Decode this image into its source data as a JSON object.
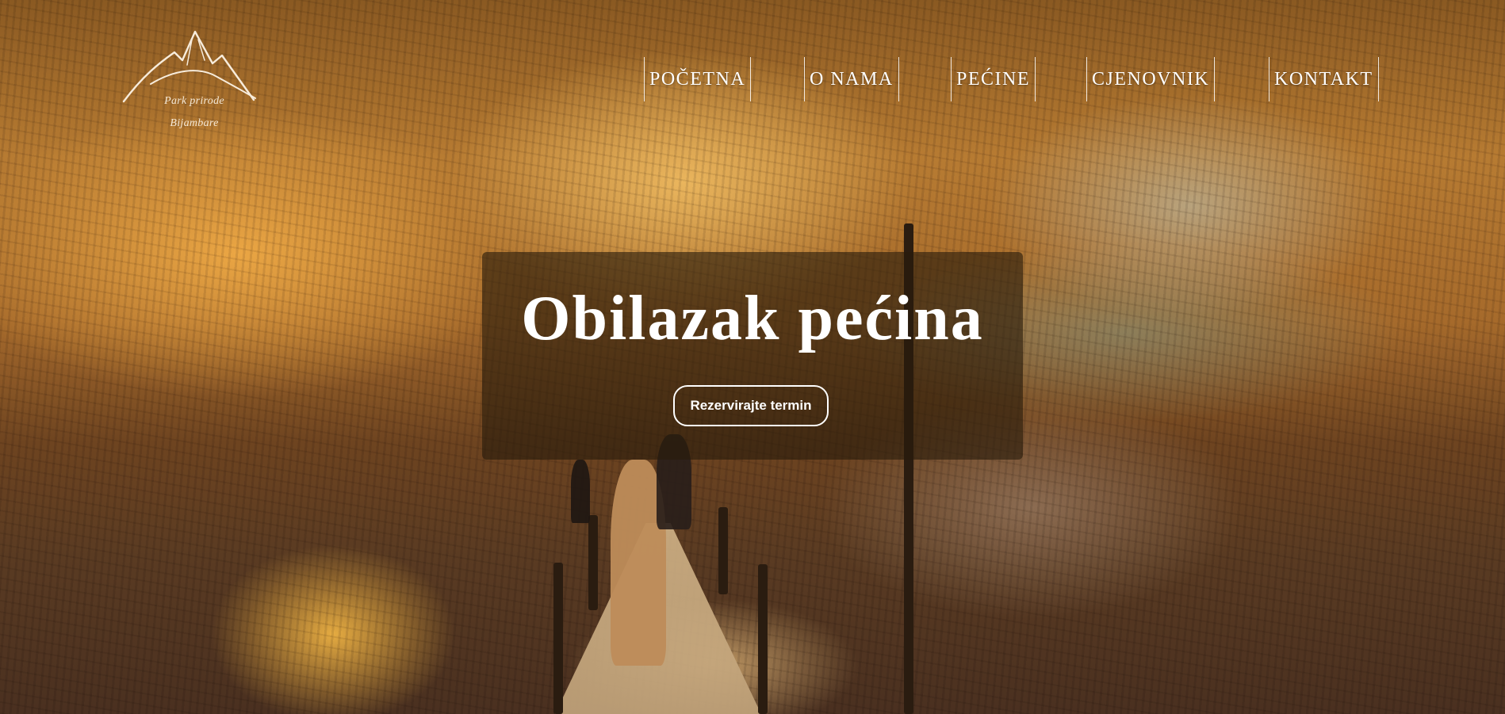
{
  "logo": {
    "line1": "Park prirode",
    "line2": "Bijambare",
    "icon": "mountain-logo-icon"
  },
  "nav": {
    "items": [
      {
        "label": "POČETNA"
      },
      {
        "label": "O NAMA"
      },
      {
        "label": "PEĆINE"
      },
      {
        "label": "CJENOVNIK"
      },
      {
        "label": "KONTAKT"
      }
    ]
  },
  "hero": {
    "title": "Obilazak pećina",
    "cta_label": "Rezervirajte termin",
    "background": "cave-photo"
  },
  "colors": {
    "text": "#ffffff",
    "panel": "#281c0c"
  }
}
